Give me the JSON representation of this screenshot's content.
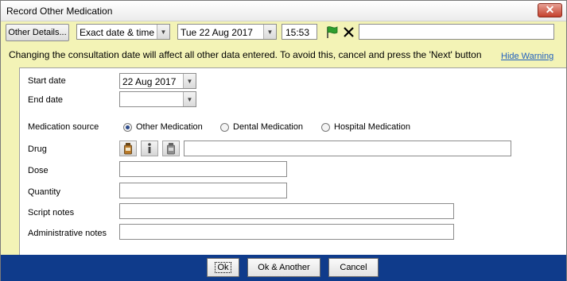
{
  "window": {
    "title": "Record Other Medication",
    "close_label": "✕"
  },
  "toolbar": {
    "other_details_label": "Other Details...",
    "date_type": "Exact date & time",
    "date_value": "Tue 22 Aug 2017",
    "time_value": "15:53",
    "free_text_value": ""
  },
  "warning": {
    "text": "Changing the consultation date will affect all other data entered. To avoid this, cancel and press the 'Next' button",
    "hide_link": "Hide Warning"
  },
  "form": {
    "start_date_label": "Start date",
    "start_date_value": "22 Aug 2017",
    "end_date_label": "End date",
    "end_date_value": "",
    "medication_source_label": "Medication source",
    "sources": [
      "Other Medication",
      "Dental Medication",
      "Hospital Medication"
    ],
    "selected_source": "Other Medication",
    "drug_label": "Drug",
    "drug_value": "",
    "dose_label": "Dose",
    "dose_value": "",
    "quantity_label": "Quantity",
    "quantity_value": "",
    "script_notes_label": "Script notes",
    "script_notes_value": "",
    "admin_notes_label": "Administrative notes",
    "admin_notes_value": ""
  },
  "footer": {
    "ok_label": "Ok",
    "ok_another_label": "Ok & Another",
    "cancel_label": "Cancel"
  },
  "colors": {
    "window_bg": "#f3f3b6",
    "footer_bg": "#0f3b8b",
    "link": "#1f5fbf",
    "close_btn": "#c4402c"
  }
}
